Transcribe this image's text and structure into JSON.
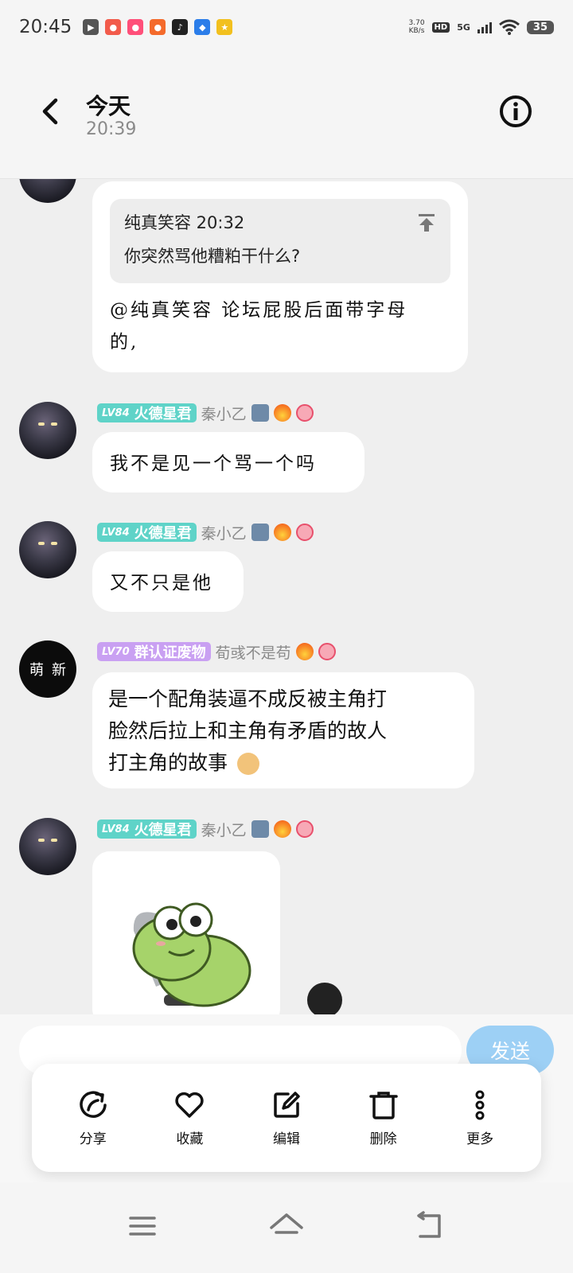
{
  "status_bar": {
    "time": "20:45",
    "net_speed_value": "3.70",
    "net_speed_unit": "KB/s",
    "hd": "HD",
    "network": "5G",
    "battery": "35",
    "app_icons": [
      {
        "name": "video-icon",
        "color": "#555555"
      },
      {
        "name": "app-red-icon",
        "color": "#f25b4b"
      },
      {
        "name": "app-pink-icon",
        "color": "#ff4f79"
      },
      {
        "name": "app-orange-icon",
        "color": "#f46a2b"
      },
      {
        "name": "tiktok-icon",
        "color": "#222222"
      },
      {
        "name": "app-blue-icon",
        "color": "#2b7de9"
      },
      {
        "name": "app-yellow-icon",
        "color": "#f2c01e"
      }
    ]
  },
  "header": {
    "title": "今天",
    "subtitle": "20:39"
  },
  "messages": {
    "m1": {
      "quote_author_time": "纯真笑容 20:32",
      "quote_text": "你突然骂他糟粕干什么?",
      "text_line1": "@纯真笑容 论坛屁股后面带字母",
      "text_line2": "的,"
    },
    "m2": {
      "level": "LV84",
      "title": "火德星君",
      "nickname": "秦小乙",
      "text": "我不是见一个骂一个吗"
    },
    "m3": {
      "level": "LV84",
      "title": "火德星君",
      "nickname": "秦小乙",
      "text": "又不只是他"
    },
    "m4": {
      "avatar_text_left": "萌",
      "avatar_text_right": "新",
      "level": "LV70",
      "title": "群认证废物",
      "nickname": "荀彧不是苟",
      "text_line1": "是一个配角装逼不成反被主角打",
      "text_line2": "脸然后拉上和主角有矛盾的故人",
      "text_line3": "打主角的故事"
    },
    "m5": {
      "level": "LV84",
      "title": "火德星君",
      "nickname": "秦小乙"
    }
  },
  "colors": {
    "tag_lv84": "#5fd3c8",
    "tag_lv70": "#c9a0f2",
    "send_button": "#9dd0f5"
  },
  "input": {
    "placeholder": "",
    "send_label": "发送"
  },
  "actions": [
    {
      "label": "分享",
      "icon": "share-icon"
    },
    {
      "label": "收藏",
      "icon": "heart-icon"
    },
    {
      "label": "编辑",
      "icon": "edit-icon"
    },
    {
      "label": "删除",
      "icon": "trash-icon"
    },
    {
      "label": "更多",
      "icon": "more-icon"
    }
  ]
}
